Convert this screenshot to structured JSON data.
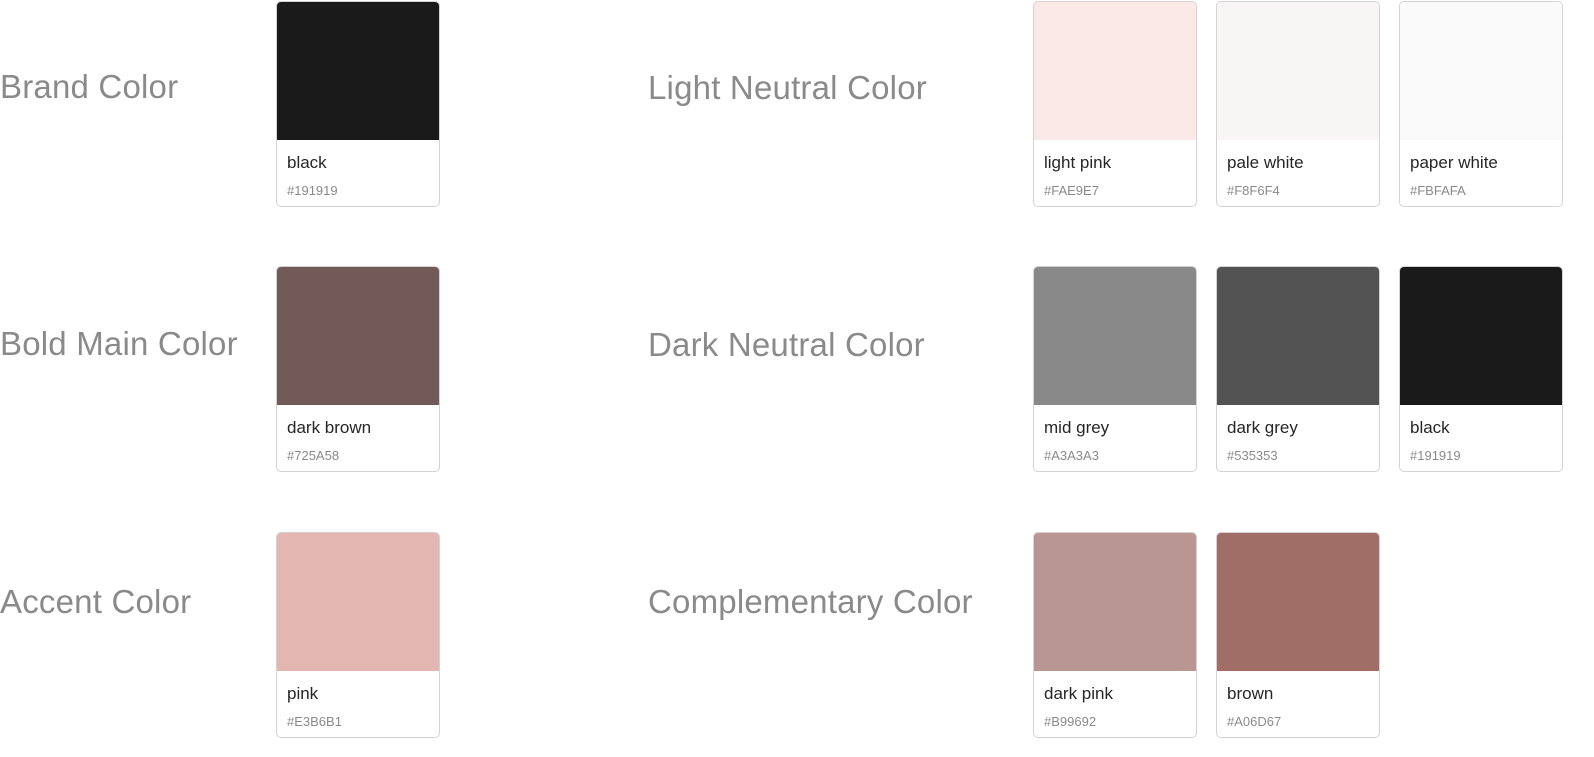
{
  "groups": [
    {
      "label": "Brand Color",
      "swatches": [
        {
          "name": "black",
          "hex": "#191919",
          "color": "#1A1A1A"
        }
      ]
    },
    {
      "label": "Bold Main Color",
      "swatches": [
        {
          "name": "dark brown",
          "hex": "#725A58",
          "color": "#725A58"
        }
      ]
    },
    {
      "label": "Accent Color",
      "swatches": [
        {
          "name": "pink",
          "hex": "#E3B6B1",
          "color": "#E3B6B1"
        }
      ]
    },
    {
      "label": "Light Neutral Color",
      "swatches": [
        {
          "name": "light pink",
          "hex": "#FAE9E7",
          "color": "#FAE9E7"
        },
        {
          "name": "pale white",
          "hex": "#F8F6F4",
          "color": "#F7F6F4"
        },
        {
          "name": "paper white",
          "hex": "#FBFAFA",
          "color": "#FAFAFA"
        }
      ]
    },
    {
      "label": "Dark Neutral Color",
      "swatches": [
        {
          "name": "mid grey",
          "hex": "#A3A3A3",
          "color": "#898989"
        },
        {
          "name": "dark grey",
          "hex": "#535353",
          "color": "#535353"
        },
        {
          "name": "black",
          "hex": "#191919",
          "color": "#1A1A1A"
        }
      ]
    },
    {
      "label": "Complementary Color",
      "swatches": [
        {
          "name": "dark pink",
          "hex": "#B99692",
          "color": "#B99692"
        },
        {
          "name": "brown",
          "hex": "#A06D67",
          "color": "#A06D67"
        }
      ]
    }
  ]
}
